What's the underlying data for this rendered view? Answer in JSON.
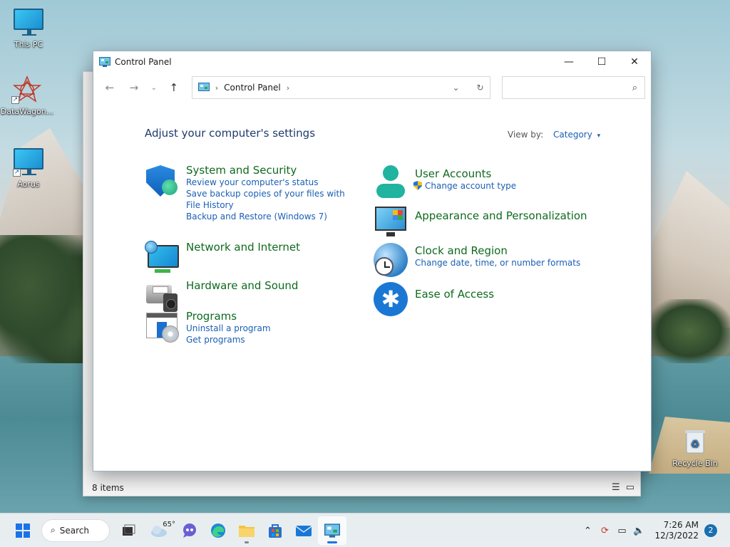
{
  "desktop": {
    "icons": [
      {
        "label": "This PC"
      },
      {
        "label": "DataWagon..."
      },
      {
        "label": "Aorus"
      },
      {
        "label": "Recycle Bin"
      }
    ]
  },
  "background_window": {
    "status": "8 items"
  },
  "window": {
    "title": "Control Panel",
    "controls": {
      "minimize": "—",
      "maximize": "☐",
      "close": "✕"
    },
    "nav": {
      "back": "←",
      "forward": "→",
      "recent": "⌄",
      "up": "↑"
    },
    "address": {
      "sep1": "›",
      "crumb": "Control Panel",
      "sep2": "›",
      "dropdown": "⌄",
      "refresh": "↻"
    },
    "search": {
      "placeholder": "",
      "icon": "⌕"
    }
  },
  "content": {
    "heading": "Adjust your computer's settings",
    "view_by_label": "View by:",
    "view_by_value": "Category",
    "view_by_caret": "▾",
    "categories_left": [
      {
        "title": "System and Security",
        "links": [
          "Review your computer's status",
          "Save backup copies of your files with File History",
          "Backup and Restore (Windows 7)"
        ]
      },
      {
        "title": "Network and Internet",
        "links": []
      },
      {
        "title": "Hardware and Sound",
        "links": []
      },
      {
        "title": "Programs",
        "links": [
          "Uninstall a program",
          "Get programs"
        ]
      }
    ],
    "categories_right": [
      {
        "title": "User Accounts",
        "links": [
          "Change account type"
        ]
      },
      {
        "title": "Appearance and Personalization",
        "links": []
      },
      {
        "title": "Clock and Region",
        "links": [
          "Change date, time, or number formats"
        ]
      },
      {
        "title": "Ease of Access",
        "links": []
      }
    ],
    "access_glyph": "✱"
  },
  "taskbar": {
    "search_label": "Search",
    "search_glyph": "⌕",
    "weather_temp": "65°",
    "time": "7:26 AM",
    "date": "12/3/2022",
    "notifications": "2",
    "tray": {
      "chevron": "⌃",
      "sync": "⟳",
      "network": "▭",
      "volume": "🔈"
    }
  },
  "colors": {
    "link": "#1a5fb4",
    "category_title": "#0f6a1e",
    "heading": "#1e3a6e",
    "accent": "#1a73e8"
  }
}
